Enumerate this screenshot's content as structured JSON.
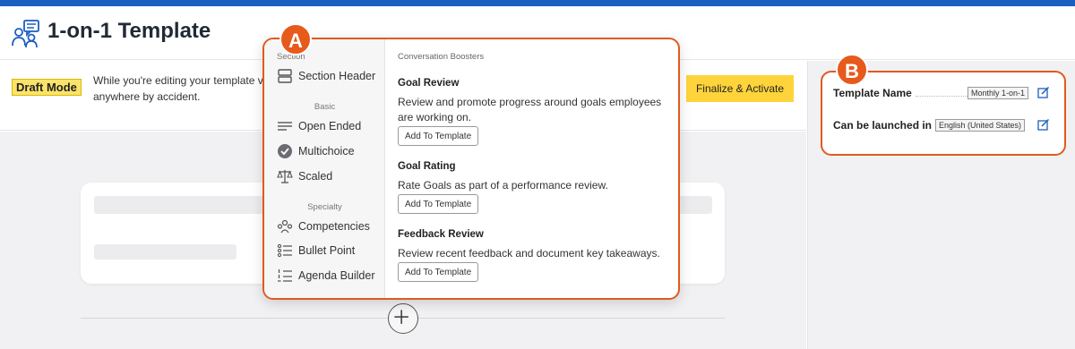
{
  "header": {
    "title": "1-on-1 Template",
    "logo_icon": "people-chat-icon"
  },
  "draft": {
    "badge": "Draft Mode",
    "text": "While you're editing your template v anywhere by accident.",
    "finalize_label": "Finalize & Activate"
  },
  "markers": {
    "a": "A",
    "b": "B"
  },
  "popup": {
    "section_label": "Section",
    "section_header": "Section Header",
    "basic_label": "Basic",
    "basic_items": [
      "Open Ended",
      "Multichoice",
      "Scaled"
    ],
    "specialty_label": "Specialty",
    "specialty_items": [
      "Competencies",
      "Bullet Point",
      "Agenda Builder"
    ],
    "boosters_heading": "Conversation Boosters",
    "boosters": [
      {
        "title": "Goal Review",
        "desc": "Review and promote progress around goals employees are working on.",
        "button": "Add To Template"
      },
      {
        "title": "Goal Rating",
        "desc": "Rate Goals as part of a performance review.",
        "button": "Add To Template"
      },
      {
        "title": "Feedback Review",
        "desc": "Review recent feedback and document key takeaways.",
        "button": "Add To Template"
      }
    ]
  },
  "properties": {
    "template_name_label": "Template Name",
    "template_name_value": "Monthly 1-on-1",
    "launch_label": "Can be launched in",
    "launch_value": "English (United States)"
  },
  "colors": {
    "accent_blue": "#1b5fc1",
    "highlight_orange": "#e05a1e",
    "button_yellow": "#ffd43b"
  }
}
